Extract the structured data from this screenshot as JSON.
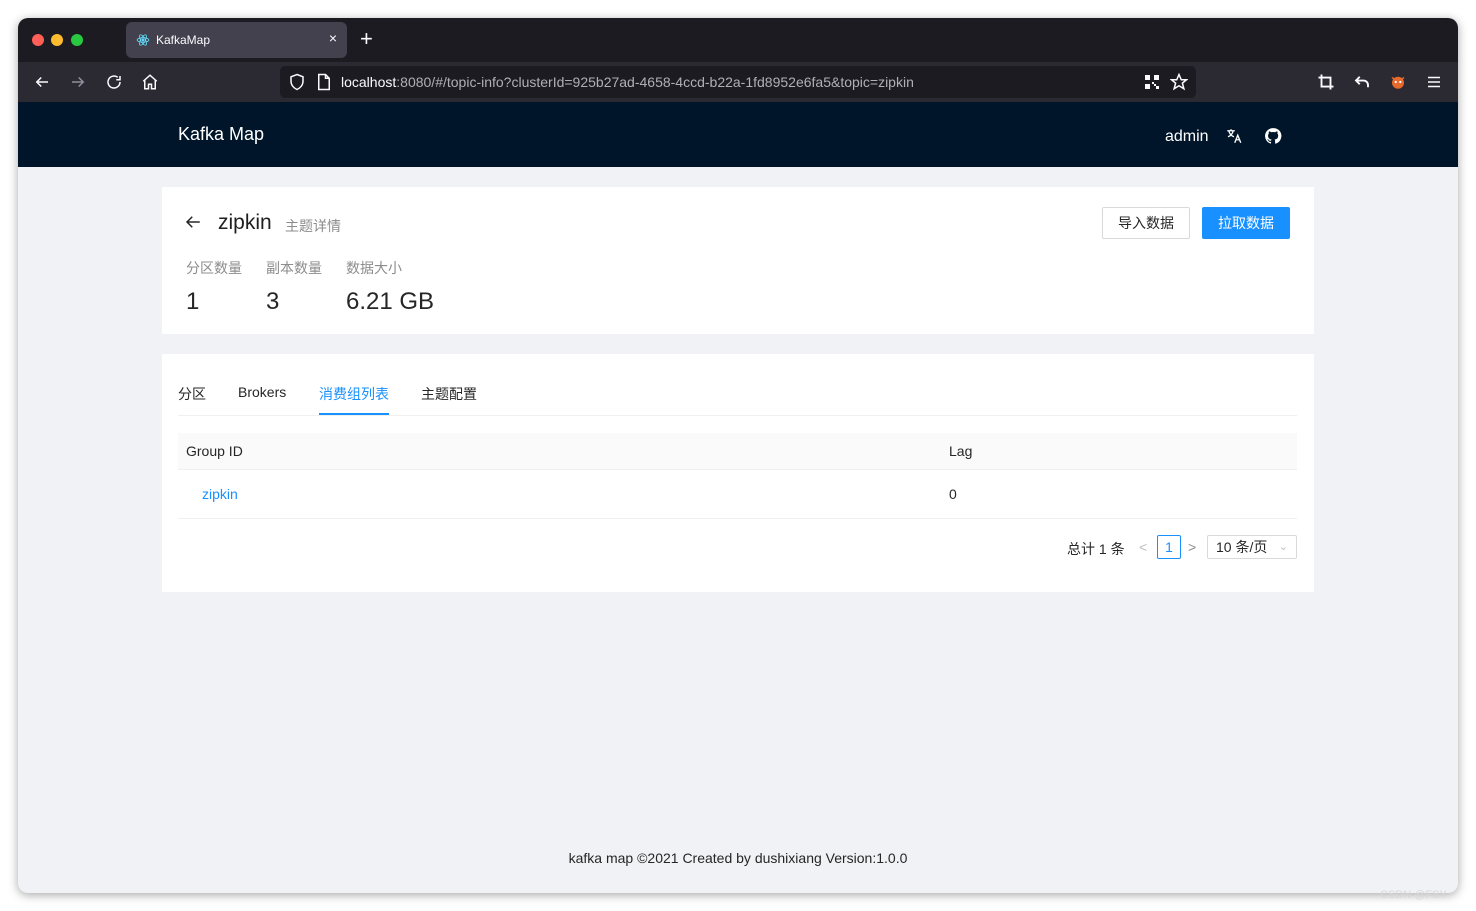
{
  "browser": {
    "tab_title": "KafkaMap",
    "tab_close": "×",
    "new_tab": "+",
    "url_host": "localhost",
    "url_rest": ":8080/#/topic-info?clusterId=925b27ad-4658-4ccd-b22a-1fd8952e6fa5&topic=zipkin"
  },
  "header": {
    "title": "Kafka Map",
    "user": "admin"
  },
  "topic": {
    "name": "zipkin",
    "subtitle": "主题详情",
    "import_button": "导入数据",
    "pull_button": "拉取数据",
    "stats": [
      {
        "label": "分区数量",
        "value": "1"
      },
      {
        "label": "副本数量",
        "value": "3"
      },
      {
        "label": "数据大小",
        "value": "6.21 GB"
      }
    ]
  },
  "tabs": [
    {
      "label": "分区"
    },
    {
      "label": "Brokers"
    },
    {
      "label": "消费组列表"
    },
    {
      "label": "主题配置"
    }
  ],
  "table": {
    "columns": [
      "Group ID",
      "Lag"
    ],
    "rows": [
      {
        "group_id": "zipkin",
        "lag": "0"
      }
    ]
  },
  "pagination": {
    "total": "总计 1 条",
    "prev": "<",
    "current": "1",
    "next": ">",
    "page_size": "10 条/页"
  },
  "footer": "kafka map ©2021 Created by dushixiang Version:1.0.0",
  "watermark": "CSDN @FSY"
}
